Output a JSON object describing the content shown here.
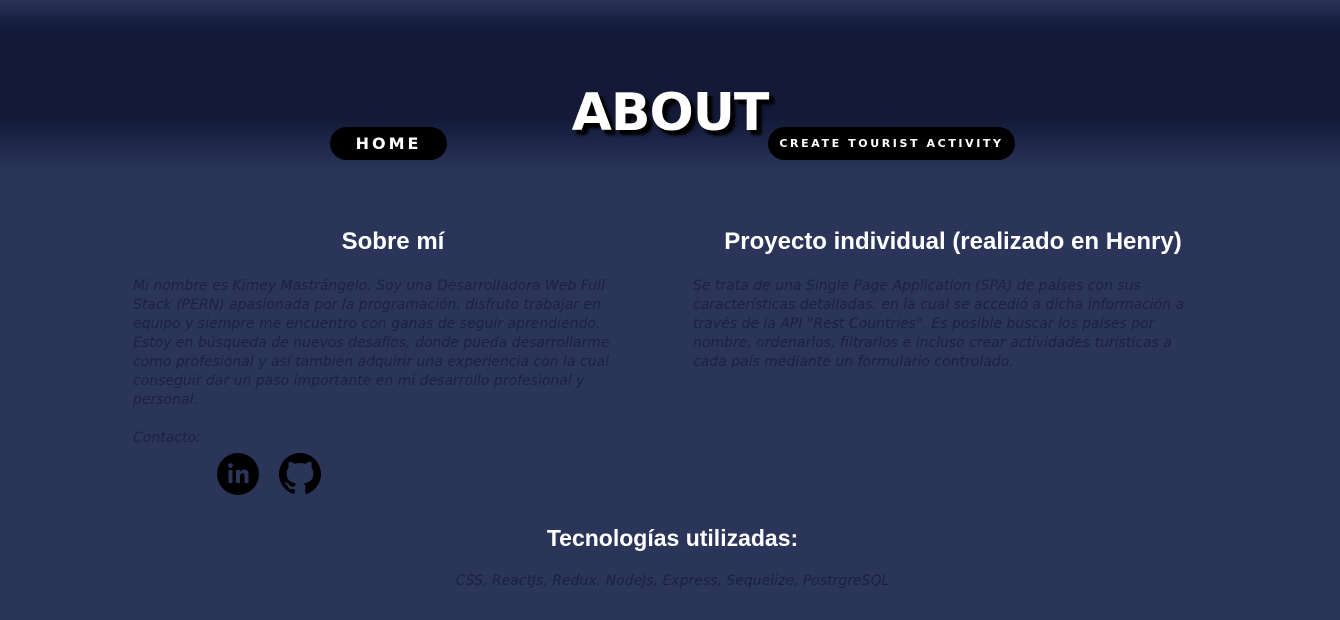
{
  "header": {
    "title": "ABOUT",
    "nav": {
      "home_label": "HOME",
      "create_label": "CREATE TOURIST ACTIVITY"
    }
  },
  "about": {
    "title": "Sobre mí",
    "text": "Mi nombre es Kimey Mastrángelo. Soy una Desarrolladora Web Full Stack (PERN) apasionada por la programación, disfruto trabajar en equipo y siempre me encuentro con ganas de seguir aprendiendo. Estoy en búsqueda de nuevos desafíos, donde pueda desarrollarme como profesional y así también adquirir una experiencia con la cual conseguir dar un paso importante en mi desarrollo profesional y personal.",
    "contact_label": "Contacto:",
    "social_icons": [
      "linkedin-icon",
      "github-icon"
    ]
  },
  "project": {
    "title": "Proyecto individual (realizado en Henry)",
    "text": "Se trata de una Single Page Application (SPA) de países con sus características detalladas, en la cual se accedió a dicha información a través de la API \"Rest Countries\". Es posible buscar los países por nombre, ordenarlos, filtrarlos e incluso crear actividades turísticas a cada país mediante un formulario controlado."
  },
  "technologies": {
    "title": "Tecnologías utilizadas:",
    "list": "CSS, ReactJs, Redux, NodeJs, Express, Sequelize, PostrgreSQL"
  },
  "colors": {
    "background": "#2b355a",
    "header_band": "#131a38",
    "button_bg": "#000000",
    "heading_text": "#ffffff",
    "body_text": "#1b2240"
  }
}
